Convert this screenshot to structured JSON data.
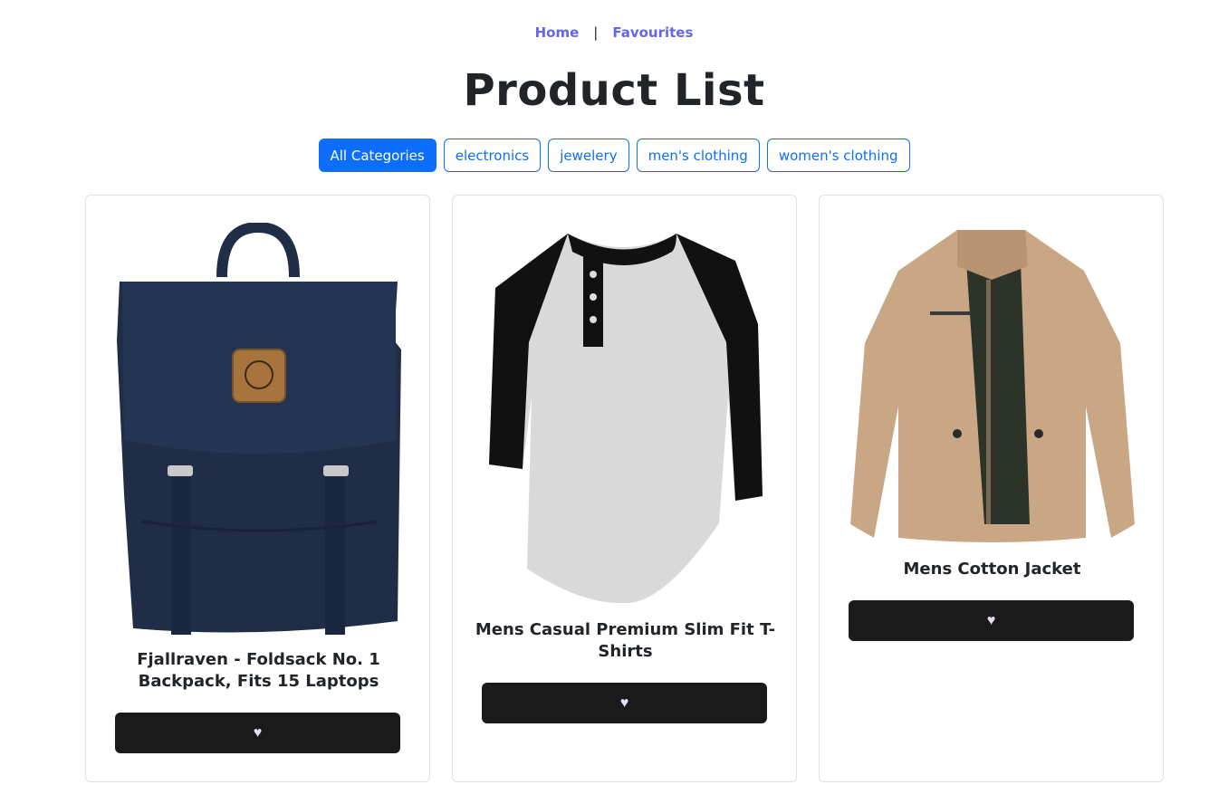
{
  "nav": {
    "home": "Home",
    "separator": "|",
    "favourites": "Favourites"
  },
  "page_title": "Product List",
  "filters": [
    {
      "label": "All Categories",
      "active": true
    },
    {
      "label": "electronics",
      "active": false
    },
    {
      "label": "jewelery",
      "active": false
    },
    {
      "label": "men's clothing",
      "active": false
    },
    {
      "label": "women's clothing",
      "active": false
    }
  ],
  "products": [
    {
      "title": "Fjallraven - Foldsack No. 1 Backpack, Fits 15 Laptops",
      "image_icon": "backpack-image",
      "fav_icon": "heart-icon",
      "fav_glyph": "♥"
    },
    {
      "title": "Mens Casual Premium Slim Fit T-Shirts",
      "image_icon": "tshirt-image",
      "fav_icon": "heart-icon",
      "fav_glyph": "♥"
    },
    {
      "title": "Mens Cotton Jacket",
      "image_icon": "jacket-image",
      "fav_icon": "heart-icon",
      "fav_glyph": "♥"
    }
  ],
  "colors": {
    "accent": "#0d6efd",
    "nav_link": "#6366f1",
    "fav_button": "#1a1a1a"
  }
}
